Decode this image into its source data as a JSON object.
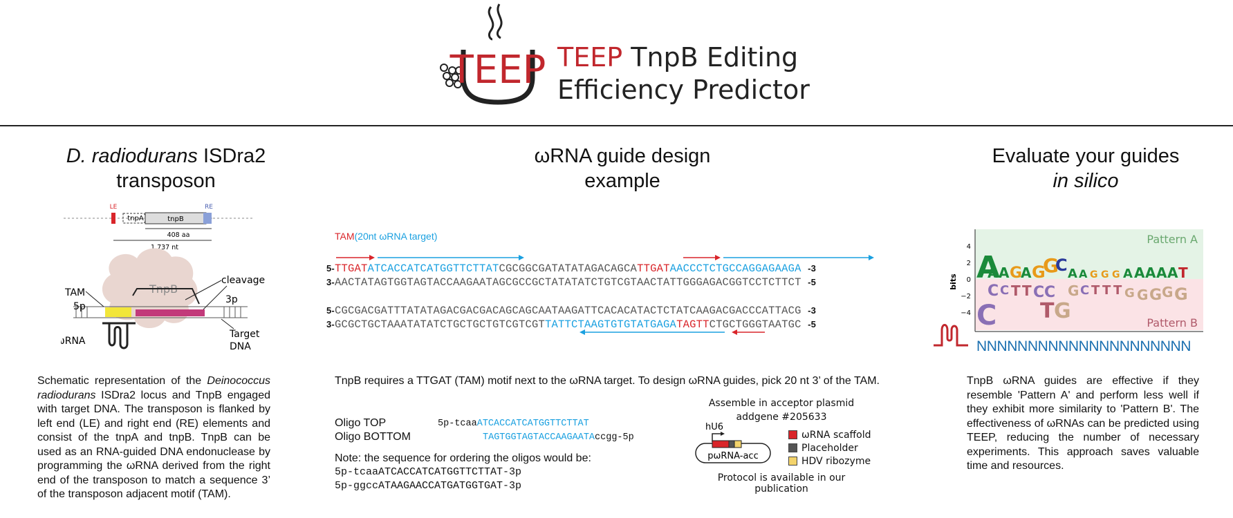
{
  "header": {
    "logo_text": "TEEP",
    "title_line1_red": "TEEP",
    "title_line1_rest": "TnpB Editing",
    "title_line2": "Efficiency Predictor"
  },
  "left": {
    "title_italic": "D. radiodurans",
    "title_rest": "ISDra2",
    "title_line2": "transposon",
    "diagram": {
      "le": "LE",
      "re": "RE",
      "tnpA": "tnpA",
      "tnpB": "tnpB",
      "aa": "408 aa",
      "nt": "1,737 nt",
      "tam": "TAM",
      "tnpb_protein": "TnpB",
      "cleavage": "cleavage",
      "p5": "5p",
      "p3": "3p",
      "omega": "ωRNA",
      "target1": "Target",
      "target2": "DNA"
    },
    "para": {
      "a": "Schematic representation of the ",
      "b": "Deinococcus radiodurans",
      "c": " ISDra2 locus and TnpB engaged with target DNA. The transposon is flanked by left end (LE) and right end (RE) elements and consist of the tnpA and tnpB. TnpB can be used as an RNA-guided DNA endonuclease by programming the ωRNA derived from the right end of the transposon to match a sequence 3’ of the transposon adjacent motif (TAM)."
    }
  },
  "middle": {
    "title_line1": "ωRNA guide design",
    "title_line2": "example",
    "key_tam": "TAM",
    "key_target": "(20nt ωRNA target)",
    "block1": {
      "top_start": "5-",
      "top_tam1": "TTGAT",
      "top_tgt1": "ATCACCATCATGGTTCTTAT",
      "top_mid": "CGCGGCGATATATAGACAGCA",
      "top_tam2": "TTGAT",
      "top_tgt2": "AACCCTCTGCCAGGAGAAGA",
      "top_end": "-3",
      "bot_start": "3-",
      "bot_seq": "AACTATAGTGGTAGTACCAAGAATAGCGCCGCTATATATCTGTCGTAACTATTGGGAGACGGTCCTCTTCT",
      "bot_end": "-5"
    },
    "block2": {
      "top_start": "5-",
      "top_seq": "CGCGACGATTTATATAGACGACGACAGCAGCAATAAGATTCACACATACTCTATCAAGACGACCCATTACG",
      "top_end": "-3",
      "bot_start": "3-",
      "bot_pre": "GCGCTGCTAAATATATCTGCTGCTGTCGTCGT",
      "bot_tgt": "TATTCTAAGTGTGTATGAGA",
      "bot_tam": "TAGTT",
      "bot_post": "CTGCTGGGTAATGC",
      "bot_end": "-5"
    },
    "para": "TnpB requires a TTGAT (TAM) motif next to the ωRNA target. To design ωRNA guides, pick 20 nt 3’ of the TAM.",
    "oligo_top_label": "Oligo TOP",
    "oligo_top_pre": "5p-tcaa",
    "oligo_top_tgt": "ATCACCATCATGGTTCTTAT",
    "oligo_bot_label": "Oligo BOTTOM",
    "oligo_bot_tgt": "TAGTGGTAGTACCAAGAATA",
    "oligo_bot_post": "ccgg-5p",
    "note": "Note: the sequence for ordering the oligos would be:",
    "order1": "5p-tcaaATCACCATCATGGTTCTTAT-3p",
    "order2": "5p-ggccATAAGAACCATGATGGTGAT-3p",
    "plasmid": {
      "assemble1": "Assemble in acceptor plasmid",
      "assemble2": "addgene #205633",
      "promoter": "hU6",
      "name": "pωRNA-acc",
      "legend": [
        {
          "label": "ωRNA scaffold",
          "color": "#d9252a"
        },
        {
          "label": "Placeholder",
          "color": "#555555"
        },
        {
          "label": "HDV ribozyme",
          "color": "#f3d36b"
        }
      ],
      "protocol": "Protocol is available in our publication"
    }
  },
  "right": {
    "title_line1": "Evaluate your guides",
    "title_line2": "in silico",
    "logo": {
      "pattern_a": "Pattern A",
      "pattern_b": "Pattern B",
      "ylabel": "bits",
      "yticks": [
        "4",
        "2",
        "0",
        "−2",
        "−4"
      ],
      "n_row": "NNNNNNNNNNNNNNNNNNNNN"
    },
    "para": "TnpB ωRNA guides are effective if they resemble 'Pattern A' and perform less well if they exhibit more similarity to 'Pattern B'. The effectiveness of ωRNAs can be predicted using TEEP, reducing the number of necessary experiments. This approach saves valuable time and resources."
  }
}
